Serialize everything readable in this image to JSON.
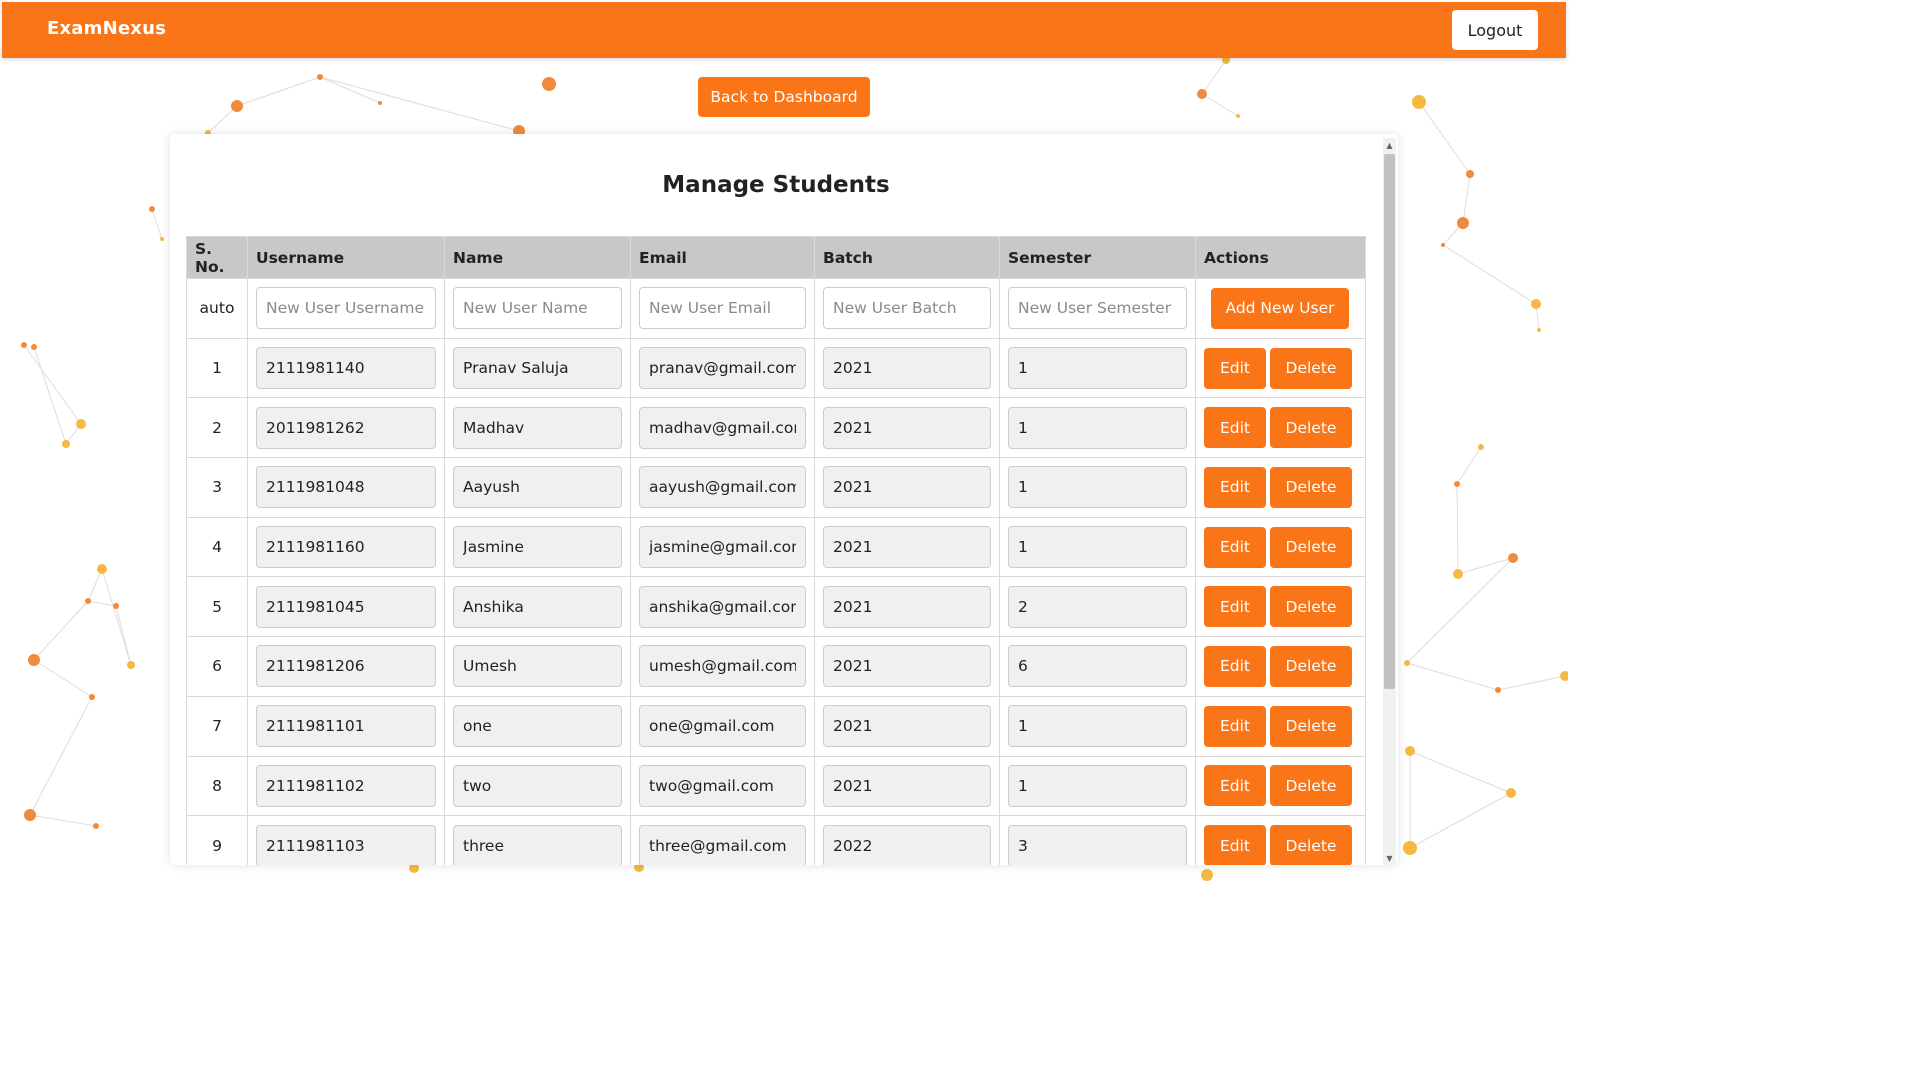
{
  "app": {
    "brand": "ExamNexus",
    "logout_label": "Logout"
  },
  "nav": {
    "back_label": "Back to Dashboard"
  },
  "page": {
    "title": "Manage Students"
  },
  "table": {
    "headers": [
      "S. No.",
      "Username",
      "Name",
      "Email",
      "Batch",
      "Semester",
      "Actions"
    ],
    "new_row": {
      "sno": "auto",
      "username_placeholder": "New User Username",
      "name_placeholder": "New User Name",
      "email_placeholder": "New User Email",
      "batch_placeholder": "New User Batch",
      "semester_placeholder": "New User Semester",
      "add_label": "Add New User"
    },
    "edit_label": "Edit",
    "delete_label": "Delete",
    "rows": [
      {
        "sno": "1",
        "username": "2111981140",
        "name": "Pranav Saluja",
        "email": "pranav@gmail.com",
        "batch": "2021",
        "semester": "1"
      },
      {
        "sno": "2",
        "username": "2011981262",
        "name": "Madhav",
        "email": "madhav@gmail.com",
        "batch": "2021",
        "semester": "1"
      },
      {
        "sno": "3",
        "username": "2111981048",
        "name": "Aayush",
        "email": "aayush@gmail.com",
        "batch": "2021",
        "semester": "1"
      },
      {
        "sno": "4",
        "username": "2111981160",
        "name": "Jasmine",
        "email": "jasmine@gmail.com",
        "batch": "2021",
        "semester": "1"
      },
      {
        "sno": "5",
        "username": "2111981045",
        "name": "Anshika",
        "email": "anshika@gmail.com",
        "batch": "2021",
        "semester": "2"
      },
      {
        "sno": "6",
        "username": "2111981206",
        "name": "Umesh",
        "email": "umesh@gmail.com",
        "batch": "2021",
        "semester": "6"
      },
      {
        "sno": "7",
        "username": "2111981101",
        "name": "one",
        "email": "one@gmail.com",
        "batch": "2021",
        "semester": "1"
      },
      {
        "sno": "8",
        "username": "2111981102",
        "name": "two",
        "email": "two@gmail.com",
        "batch": "2021",
        "semester": "1"
      },
      {
        "sno": "9",
        "username": "2111981103",
        "name": "three",
        "email": "three@gmail.com",
        "batch": "2022",
        "semester": "3"
      }
    ]
  },
  "theme": {
    "accent": "#f97517",
    "header_bg": "#c8c8c8",
    "network_dot": "#f5b942",
    "network_dot_alt": "#f08a3c"
  }
}
